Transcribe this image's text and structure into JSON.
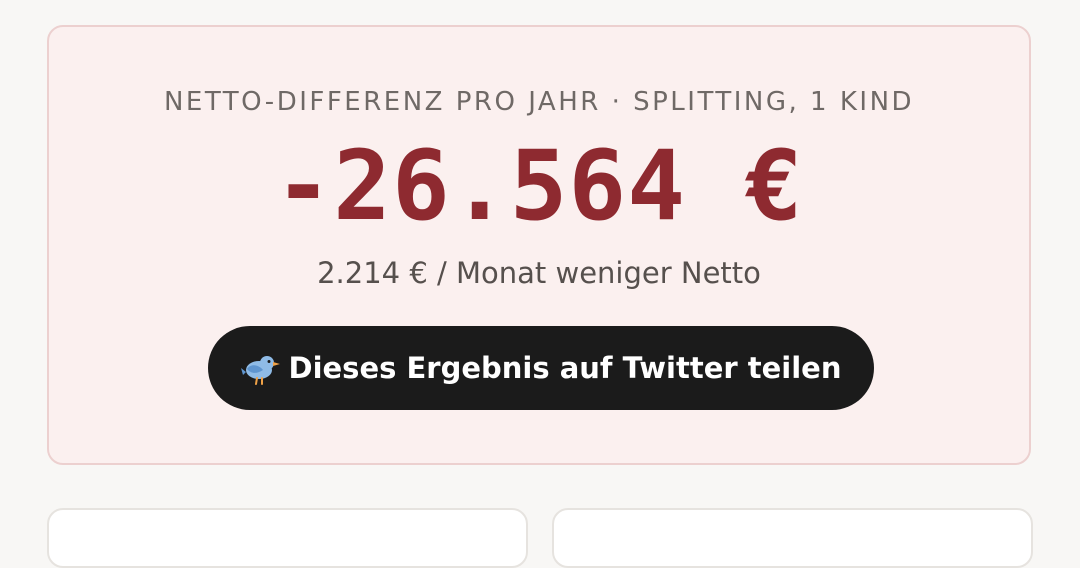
{
  "result": {
    "subtitle": "NETTO-DIFFERENZ PRO JAHR · SPLITTING, 1 KIND",
    "amount": "-26.564 €",
    "monthly": "2.214 € / Monat weniger Netto",
    "share_label": "Dieses Ergebnis auf Twitter teilen",
    "share_icon": "bird-icon"
  },
  "colors": {
    "amount": "#8e2a30",
    "card_background": "#fbf0ef",
    "card_border": "#ecd0cf",
    "button_background": "#1b1b1b"
  }
}
